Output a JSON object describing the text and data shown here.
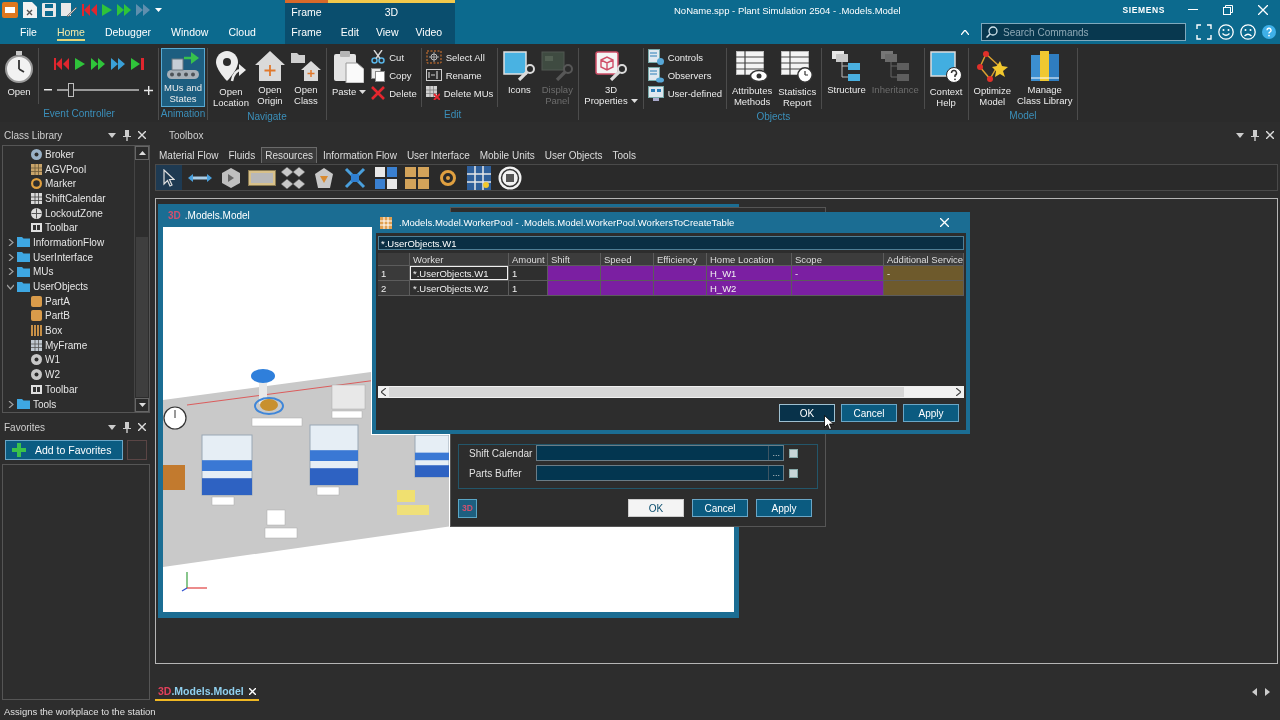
{
  "window": {
    "title": "NoName.spp - Plant Simulation 2504 - .Models.Model",
    "brand": "SIEMENS"
  },
  "ribbon_tabs": [
    {
      "label": "File",
      "selected": false
    },
    {
      "label": "Home",
      "selected": true
    },
    {
      "label": "Debugger",
      "selected": false
    },
    {
      "label": "Window",
      "selected": false
    },
    {
      "label": "Cloud",
      "selected": false
    }
  ],
  "contextual_tabs": [
    {
      "label": "Frame",
      "color": "#d8692a",
      "tabs": [
        {
          "label": "Frame",
          "selected": false
        }
      ]
    },
    {
      "label": "3D",
      "color": "#f2c94c",
      "tabs": [
        {
          "label": "Edit",
          "selected": false
        },
        {
          "label": "View",
          "selected": false
        },
        {
          "label": "Video",
          "selected": false
        }
      ]
    }
  ],
  "search": {
    "placeholder": "Search Commands"
  },
  "ribbon": {
    "groups": [
      {
        "label": "Event Controller",
        "items": [
          {
            "kind": "large",
            "label": "Open",
            "on": false,
            "disabled": false,
            "caret": false
          },
          {
            "kind": "separator"
          },
          {
            "kind": "player",
            "level": 0.17
          }
        ]
      },
      {
        "label": "Animation",
        "items": [
          {
            "kind": "large",
            "label": "MUs and\nStates",
            "on": true,
            "disabled": false,
            "caret": false
          }
        ]
      },
      {
        "label": "Navigate",
        "items": [
          {
            "kind": "large",
            "label": "Open\nLocation",
            "on": false,
            "disabled": false,
            "caret": false
          },
          {
            "kind": "large",
            "label": "Open\nOrigin",
            "on": false,
            "disabled": false,
            "caret": false
          },
          {
            "kind": "large",
            "label": "Open\nClass",
            "on": false,
            "disabled": false,
            "caret": false
          }
        ]
      },
      {
        "label": "Edit",
        "items": [
          {
            "kind": "large",
            "label": "Paste",
            "on": false,
            "disabled": false,
            "caret": true
          },
          {
            "kind": "stack",
            "buttons": [
              {
                "label": "Cut"
              },
              {
                "label": "Copy"
              },
              {
                "label": "Delete"
              }
            ]
          },
          {
            "kind": "separator"
          },
          {
            "kind": "stack",
            "buttons": [
              {
                "label": "Select All"
              },
              {
                "label": "Rename"
              },
              {
                "label": "Delete MUs"
              }
            ]
          },
          {
            "kind": "separator"
          },
          {
            "kind": "large",
            "label": "Icons",
            "on": false,
            "disabled": false,
            "caret": false
          },
          {
            "kind": "large",
            "label": "Display\nPanel",
            "on": false,
            "disabled": true,
            "caret": false
          }
        ]
      },
      {
        "label": "Objects",
        "items": [
          {
            "kind": "large",
            "label": "3D\nProperties",
            "on": false,
            "disabled": false,
            "caret": true
          },
          {
            "kind": "separator"
          },
          {
            "kind": "stack",
            "buttons": [
              {
                "label": "Controls"
              },
              {
                "label": "Observers"
              },
              {
                "label": "User-defined"
              }
            ]
          },
          {
            "kind": "separator"
          },
          {
            "kind": "large",
            "label": "Attributes\nMethods",
            "on": false,
            "disabled": false,
            "caret": false
          },
          {
            "kind": "large",
            "label": "Statistics\nReport",
            "on": false,
            "disabled": false,
            "caret": false
          },
          {
            "kind": "separator"
          },
          {
            "kind": "large",
            "label": "Structure",
            "on": false,
            "disabled": false,
            "caret": false
          },
          {
            "kind": "large",
            "label": "Inheritance",
            "on": false,
            "disabled": true,
            "caret": false
          },
          {
            "kind": "separator"
          },
          {
            "kind": "large",
            "label": "Context\nHelp",
            "on": false,
            "disabled": false,
            "caret": false
          }
        ]
      },
      {
        "label": "Model",
        "items": [
          {
            "kind": "large",
            "label": "Optimize\nModel",
            "on": false,
            "disabled": false,
            "caret": false
          },
          {
            "kind": "large",
            "label": "Manage\nClass Library",
            "on": false,
            "disabled": false,
            "caret": false
          }
        ]
      }
    ]
  },
  "class_library": {
    "title": "Class Library",
    "tree": [
      {
        "children": [
          {
            "kind": "class",
            "label": "Broker"
          },
          {
            "kind": "class",
            "label": "AGVPool"
          },
          {
            "kind": "class",
            "label": "Marker"
          },
          {
            "kind": "class",
            "label": "ShiftCalendar"
          },
          {
            "kind": "class",
            "label": "LockoutZone"
          },
          {
            "kind": "class",
            "label": "Toolbar"
          }
        ]
      },
      {
        "kind": "folder",
        "label": "InformationFlow",
        "expanded": false
      },
      {
        "kind": "folder",
        "label": "UserInterface",
        "expanded": false
      },
      {
        "kind": "folder",
        "label": "MUs",
        "expanded": false
      },
      {
        "kind": "folder",
        "label": "UserObjects",
        "expanded": true,
        "children": [
          {
            "kind": "class",
            "label": "PartA"
          },
          {
            "kind": "class",
            "label": "PartB"
          },
          {
            "kind": "class",
            "label": "Box"
          },
          {
            "kind": "class",
            "label": "MyFrame"
          },
          {
            "kind": "class",
            "label": "W1"
          },
          {
            "kind": "class",
            "label": "W2"
          },
          {
            "kind": "class",
            "label": "Toolbar"
          }
        ]
      },
      {
        "kind": "folder",
        "label": "Tools",
        "expanded": false
      }
    ]
  },
  "favorites": {
    "title": "Favorites",
    "add_button": "Add to Favorites"
  },
  "toolbox": {
    "title": "Toolbox",
    "tabs": [
      {
        "label": "Material Flow",
        "selected": false
      },
      {
        "label": "Fluids",
        "selected": false
      },
      {
        "label": "Resources",
        "selected": true
      },
      {
        "label": "Information Flow",
        "selected": false
      },
      {
        "label": "User Interface",
        "selected": false
      },
      {
        "label": "Mobile Units",
        "selected": false
      },
      {
        "label": "User Objects",
        "selected": false
      },
      {
        "label": "Tools",
        "selected": false
      }
    ],
    "tools": [
      {
        "selected": true
      },
      {
        "selected": false
      },
      {
        "selected": false
      },
      {
        "selected": false
      },
      {
        "selected": false
      },
      {
        "selected": false
      },
      {
        "selected": false
      },
      {
        "selected": false
      },
      {
        "selected": false
      },
      {
        "selected": false
      },
      {
        "selected": false
      },
      {
        "selected": false
      }
    ]
  },
  "model_window": {
    "badge": "3D",
    "title": ".Models.Model"
  },
  "workerpool_dialog": {
    "fields": [
      {
        "label": "Shift Calendar",
        "browse": "...",
        "checked": false
      },
      {
        "label": "Parts Buffer",
        "browse": "...",
        "checked": false
      }
    ],
    "badge_button": "3D",
    "buttons": [
      {
        "label": "OK",
        "default": true
      },
      {
        "label": "Cancel",
        "default": false
      },
      {
        "label": "Apply",
        "default": false
      }
    ]
  },
  "table_dialog": {
    "title": ".Models.Model.WorkerPool - .Models.Model.WorkerPool.WorkersToCreateTable",
    "editor_value": "*.UserObjects.W1",
    "columns": [
      {
        "label": "Worker"
      },
      {
        "label": "Amount"
      },
      {
        "label": "Shift",
        "color": "#7b1fa2"
      },
      {
        "label": "Speed",
        "color": "#7b1fa2"
      },
      {
        "label": "Efficiency",
        "color": "#7b1fa2"
      },
      {
        "label": "Home Location",
        "color": "#7b1fa2"
      },
      {
        "label": "Scope",
        "color": "#7b1fa2"
      },
      {
        "label": "Additional Service",
        "color": "#6e5a2c"
      }
    ],
    "rows": [
      {
        "index": "1",
        "cells": [
          {
            "text": "*.UserObjects.W1",
            "selected": true
          },
          {
            "text": "1",
            "selected": false
          },
          {
            "selected": false
          },
          {
            "selected": false
          },
          {
            "selected": false
          },
          {
            "text": "H_W1",
            "selected": false
          },
          {
            "text": "-",
            "selected": false
          },
          {
            "text": "-",
            "selected": false
          }
        ]
      },
      {
        "index": "2",
        "cells": [
          {
            "text": "*.UserObjects.W2",
            "selected": false
          },
          {
            "text": "1",
            "selected": false
          },
          {
            "selected": false
          },
          {
            "selected": false
          },
          {
            "selected": false
          },
          {
            "text": "H_W2",
            "selected": false
          },
          {
            "selected": false
          },
          {
            "selected": false
          }
        ]
      }
    ],
    "buttons": [
      {
        "label": "OK",
        "default": true
      },
      {
        "label": "Cancel",
        "default": false
      },
      {
        "label": "Apply",
        "default": false
      }
    ]
  },
  "document_tabs": [
    {
      "badge": "3D",
      "label": ".Models.Model",
      "selected": true
    }
  ],
  "status_bar": {
    "text": "Assigns the workplace to the station"
  }
}
